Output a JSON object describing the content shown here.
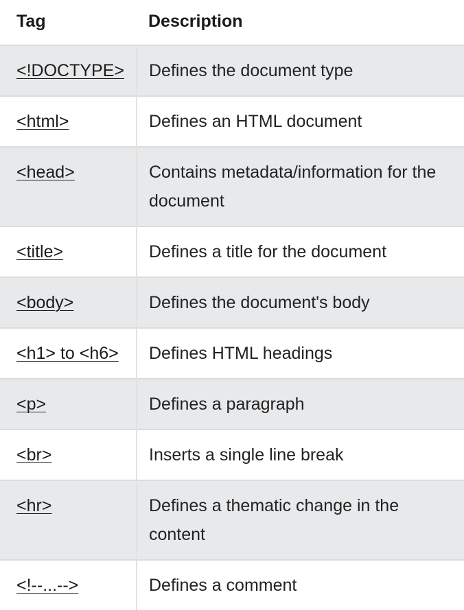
{
  "table": {
    "headers": {
      "tag": "Tag",
      "description": "Description"
    },
    "rows": [
      {
        "tag": "<!DOCTYPE>",
        "description": "Defines the document type"
      },
      {
        "tag": "<html>",
        "description": "Defines an HTML document"
      },
      {
        "tag": "<head>",
        "description": "Contains metadata/information for the document"
      },
      {
        "tag": "<title>",
        "description": "Defines a title for the document"
      },
      {
        "tag": "<body>",
        "description": "Defines the document's body"
      },
      {
        "tag": "<h1> to <h6>",
        "description": "Defines HTML headings"
      },
      {
        "tag": "<p>",
        "description": "Defines a paragraph"
      },
      {
        "tag": "<br>",
        "description": "Inserts a single line break"
      },
      {
        "tag": "<hr>",
        "description": "Defines a thematic change in the content"
      },
      {
        "tag": "<!--...-->",
        "description": "Defines a comment"
      }
    ]
  },
  "colors": {
    "stripe": "#e7e9eb",
    "text": "#222222"
  }
}
